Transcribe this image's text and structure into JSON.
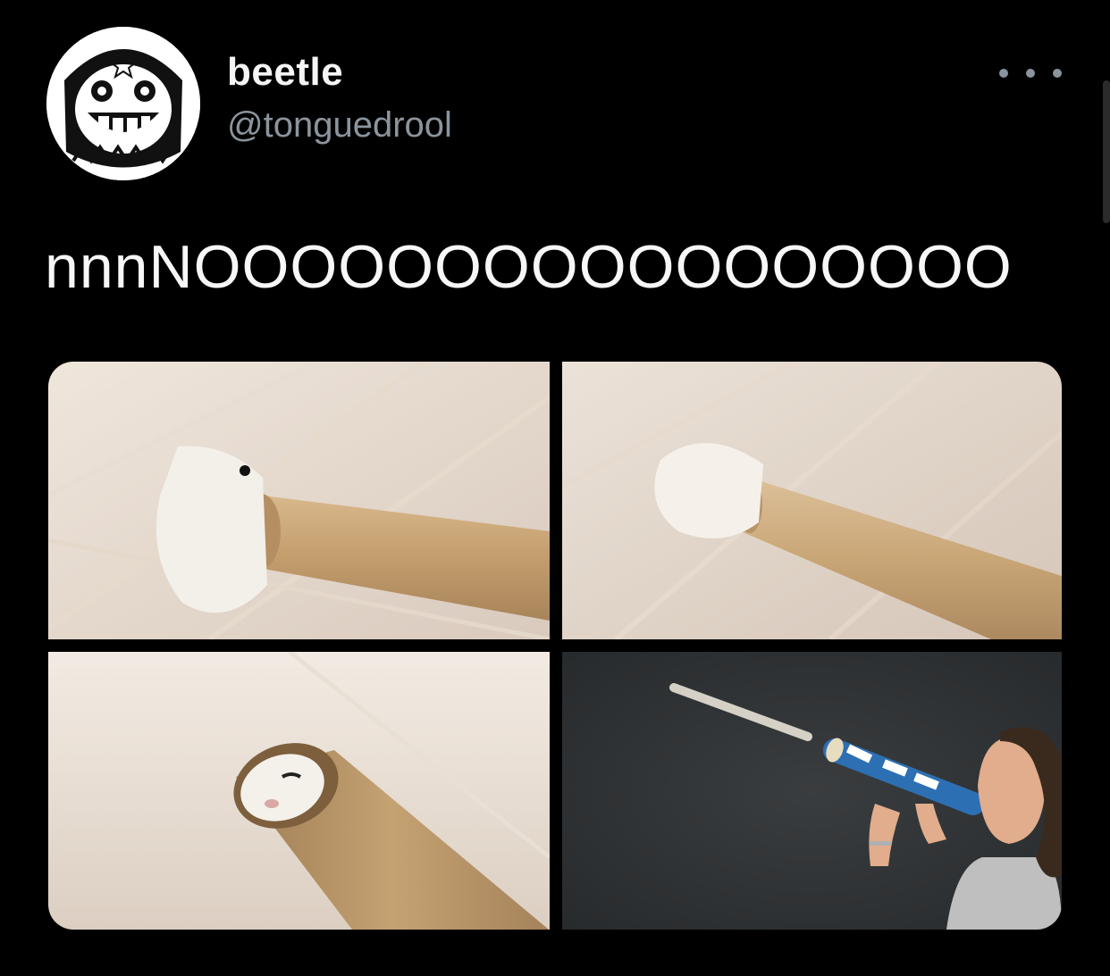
{
  "tweet": {
    "author": {
      "display_name": "beetle",
      "handle": "@tonguedrool",
      "avatar_icon": "grinning-face-avatar"
    },
    "more_icon": "more-options-icon",
    "text": "nnnNOOOOOOOOOOOOOOOOO",
    "media": [
      {
        "icon": "hamster-entering-tube-image"
      },
      {
        "icon": "hamster-inside-tube-image"
      },
      {
        "icon": "hamster-peeking-from-tube-image"
      },
      {
        "icon": "woman-blowing-tube-image"
      }
    ]
  },
  "colors": {
    "background": "#000000",
    "text": "#f5f5f5",
    "secondary_text": "#8b949c"
  }
}
